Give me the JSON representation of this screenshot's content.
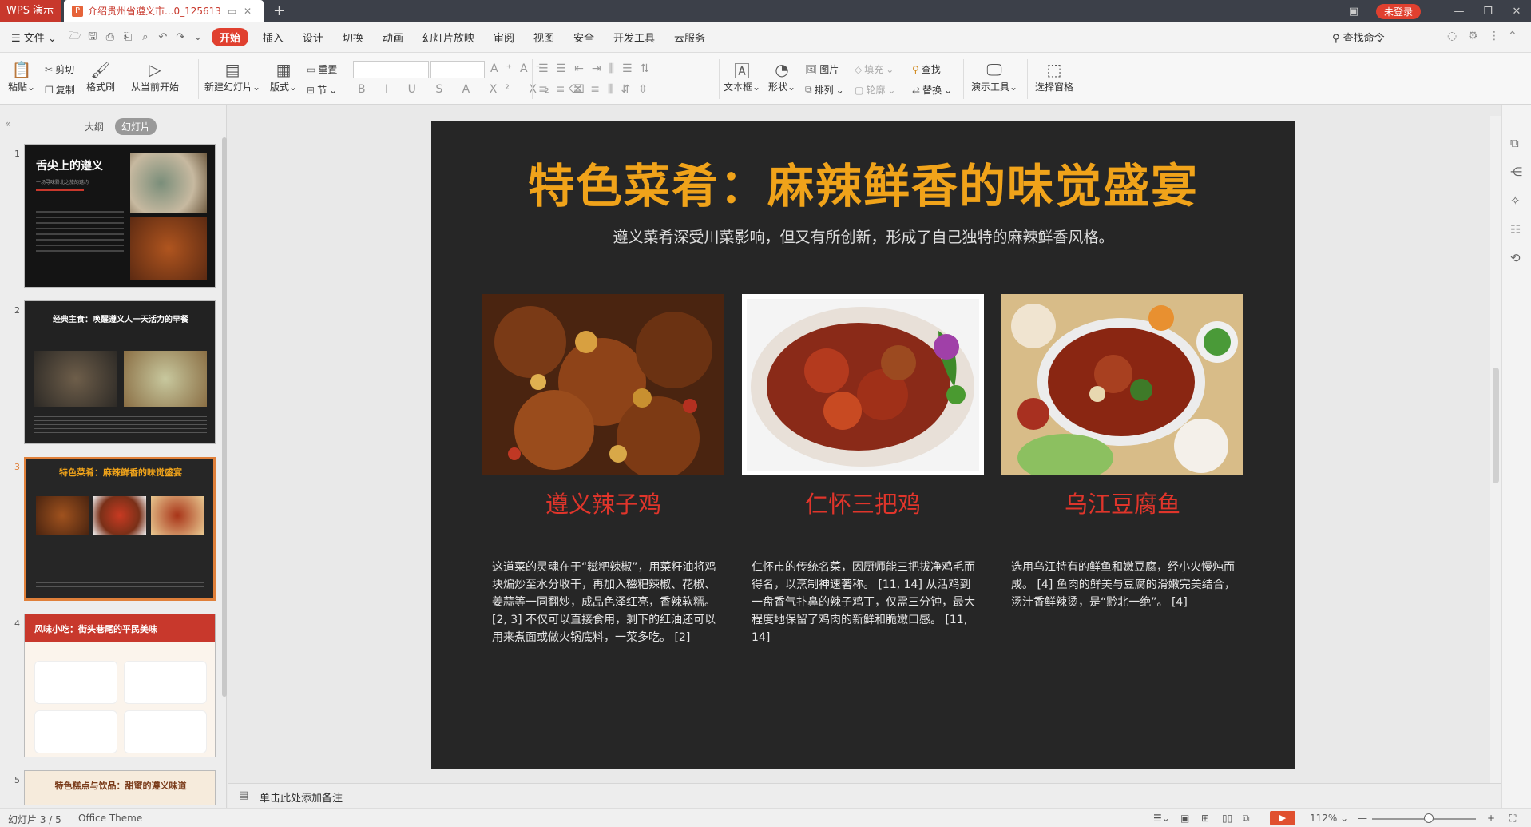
{
  "titlebar": {
    "app_name": "WPS 演示",
    "doc_tab": "介绍贵州省遵义市...0_125613",
    "new_tab": "+",
    "login": "未登录"
  },
  "menu": {
    "file": "文件",
    "items": [
      "开始",
      "插入",
      "设计",
      "切换",
      "动画",
      "幻灯片放映",
      "审阅",
      "视图",
      "安全",
      "开发工具",
      "云服务"
    ],
    "search_cmd": "查找命令"
  },
  "ribbon": {
    "paste": "粘贴",
    "cut": "剪切",
    "copy": "复制",
    "format_painter": "格式刷",
    "from_current": "从当前开始",
    "new_slide": "新建幻灯片",
    "layout": "版式",
    "reset": "重置",
    "section": "节",
    "textbox": "文本框",
    "shape": "形状",
    "picture": "图片",
    "arrange": "排列",
    "fill": "填充",
    "outline": "轮廓",
    "find": "查找",
    "replace": "替换",
    "present_tools": "演示工具",
    "selection_pane": "选择窗格"
  },
  "left_panel": {
    "tab_outline": "大纲",
    "tab_slides": "幻灯片",
    "thumbnails": [
      {
        "num": "1",
        "title": "舌尖上的遵义",
        "subtitle": "一场寻味黔北之旅的邀约"
      },
      {
        "num": "2",
        "title": "经典主食：唤醒遵义人一天活力的早餐"
      },
      {
        "num": "3",
        "title": "特色菜肴：麻辣鲜香的味觉盛宴"
      },
      {
        "num": "4",
        "title": "风味小吃：街头巷尾的平民美味"
      },
      {
        "num": "5",
        "title": "特色糕点与饮品：甜蜜的遵义味道"
      }
    ]
  },
  "slide": {
    "title": "特色菜肴：麻辣鲜香的味觉盛宴",
    "subtitle": "遵义菜肴深受川菜影响，但又有所创新，形成了自己独特的麻辣鲜香风格。",
    "dishes": [
      {
        "name": "遵义辣子鸡",
        "desc": "这道菜的灵魂在于“糍粑辣椒”，用菜籽油将鸡块煸炒至水分收干，再加入糍粑辣椒、花椒、姜蒜等一同翻炒，成品色泽红亮，香辣软糯。 [2, 3] 不仅可以直接食用，剩下的红油还可以用来煮面或做火锅底料，一菜多吃。 [2]"
      },
      {
        "name": "仁怀三把鸡",
        "desc": "仁怀市的传统名菜，因厨师能三把拔净鸡毛而得名，以烹制神速著称。 [11, 14] 从活鸡到一盘香气扑鼻的辣子鸡丁，仅需三分钟，最大程度地保留了鸡肉的新鲜和脆嫩口感。 [11, 14]"
      },
      {
        "name": "乌江豆腐鱼",
        "desc": "选用乌江特有的鲜鱼和嫩豆腐，经小火慢炖而成。 [4] 鱼肉的鲜美与豆腐的滑嫩完美结合，汤汁香鲜辣烫，是“黔北一绝”。 [4]"
      }
    ]
  },
  "notes": {
    "placeholder": "单击此处添加备注"
  },
  "status": {
    "slide_count": "幻灯片 3 / 5",
    "theme": "Office Theme",
    "zoom": "112%"
  },
  "colors": {
    "accent": "#e0402f",
    "slide_bg": "#262626",
    "title_gold": "#f0a31a",
    "dish_red": "#e0352b"
  }
}
